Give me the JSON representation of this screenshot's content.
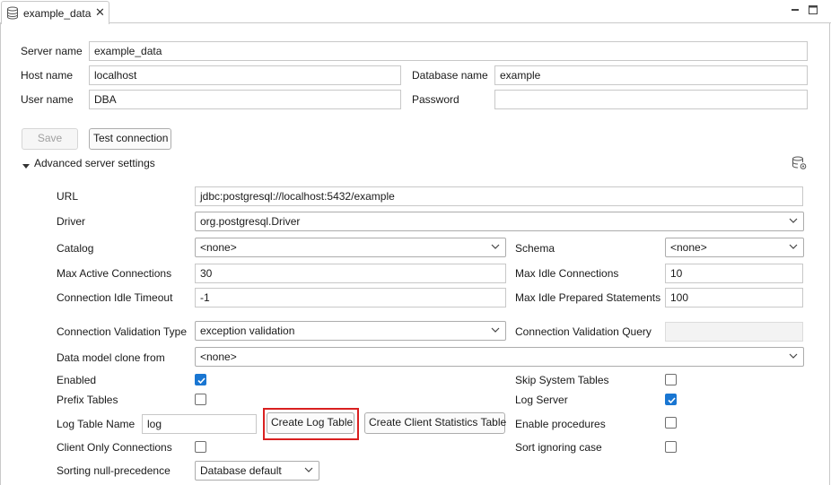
{
  "tab": {
    "title": "example_data"
  },
  "server": {
    "server_name_label": "Server name",
    "server_name_value": "example_data",
    "host_name_label": "Host name",
    "host_name_value": "localhost",
    "database_name_label": "Database name",
    "database_name_value": "example",
    "user_name_label": "User name",
    "user_name_value": "DBA",
    "password_label": "Password",
    "password_value": ""
  },
  "actions": {
    "save_label": "Save",
    "test_connection_label": "Test connection"
  },
  "advanced": {
    "toggle_label": "Advanced server settings",
    "url_label": "URL",
    "url_value": "jdbc:postgresql://localhost:5432/example",
    "driver_label": "Driver",
    "driver_value": "org.postgresql.Driver",
    "catalog_label": "Catalog",
    "catalog_value": "<none>",
    "schema_label": "Schema",
    "schema_value": "<none>",
    "max_active_label": "Max Active Connections",
    "max_active_value": "30",
    "max_idle_label": "Max Idle Connections",
    "max_idle_value": "10",
    "idle_timeout_label": "Connection Idle Timeout",
    "idle_timeout_value": "-1",
    "max_idle_prepared_label": "Max Idle Prepared Statements",
    "max_idle_prepared_value": "100",
    "validation_type_label": "Connection Validation Type",
    "validation_type_value": "exception validation",
    "validation_query_label": "Connection Validation Query",
    "validation_query_value": "",
    "clone_from_label": "Data model clone from",
    "clone_from_value": "<none>",
    "enabled_label": "Enabled",
    "enabled_checked": true,
    "skip_system_tables_label": "Skip System Tables",
    "skip_system_tables_checked": false,
    "prefix_tables_label": "Prefix Tables",
    "prefix_tables_checked": false,
    "log_server_label": "Log Server",
    "log_server_checked": true,
    "log_table_name_label": "Log Table Name",
    "log_table_name_value": "log",
    "create_log_table_label": "Create Log Table",
    "create_client_stats_label": "Create Client Statistics Table",
    "enable_procedures_label": "Enable procedures",
    "enable_procedures_checked": false,
    "client_only_label": "Client Only Connections",
    "client_only_checked": false,
    "sort_ignoring_case_label": "Sort ignoring case",
    "sort_ignoring_case_checked": false,
    "null_precedence_label": "Sorting null-precedence",
    "null_precedence_value": "Database default"
  },
  "icons": {
    "tab_icon": "database-icon",
    "minimize": "minimize-icon",
    "maximize": "maximize-icon",
    "expand": "triangle-down-icon",
    "settings": "database-settings-icon",
    "check": "check-icon",
    "dropdown": "chevron-down-icon"
  },
  "colors": {
    "checkbox_on": "#1976d2",
    "highlight": "#d92020"
  }
}
